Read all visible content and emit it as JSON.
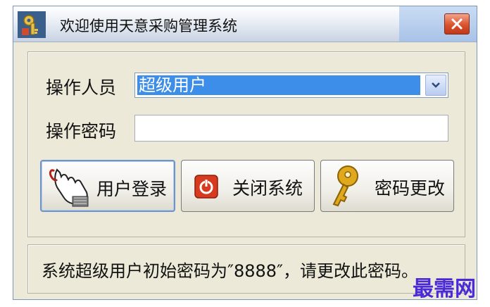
{
  "window": {
    "title": "欢迎使用天意采购管理系统",
    "close_symbol": "×"
  },
  "form": {
    "operator_label": "操作人员",
    "operator_value": "超级用户",
    "password_label": "操作密码",
    "password_value": ""
  },
  "buttons": {
    "login": "用户登录",
    "close_system": "关闭系统",
    "change_password": "密码更改"
  },
  "note": "系统超级用户初始密码为″8888″，请更改此密码。",
  "watermark": "最需网",
  "colors": {
    "selection": "#3d8ee8",
    "close_red": "#d9532c",
    "power_red": "#d63b1f",
    "key_gold": "#e0a81c",
    "watermark": "#4a2ad8"
  },
  "icons": {
    "app": "key-app-icon",
    "login": "hand-pointer-icon",
    "close_system": "power-icon",
    "change_password": "key-icon"
  }
}
